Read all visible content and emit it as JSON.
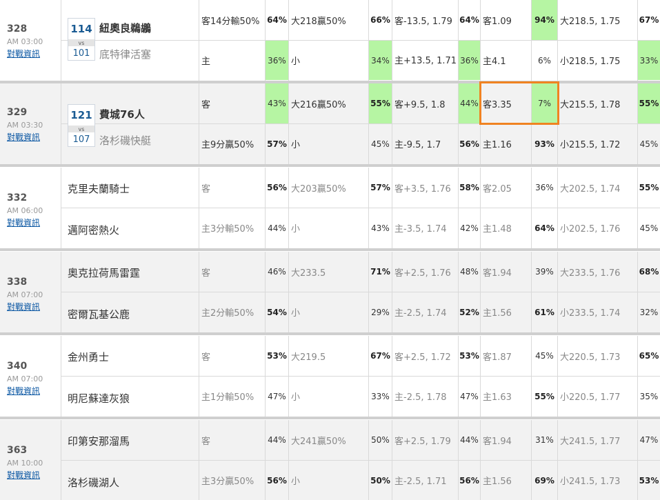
{
  "link_label": "對戰資訊",
  "vs_label": "vs",
  "games": [
    {
      "id": "328",
      "time": "AM 03:00",
      "shaded": false,
      "rotation": true,
      "dim_odds": false,
      "teams": [
        {
          "name": "紐奧良鵜鶘",
          "num": "114",
          "style": "strong"
        },
        {
          "name": "底特律活塞",
          "num": "101",
          "style": "dim"
        }
      ],
      "rows": [
        [
          {
            "t": "客14分輸50%",
            "w": "n"
          },
          {
            "t": "64%",
            "w": "b"
          },
          {
            "t": "大218贏50%",
            "w": "n"
          },
          {
            "t": "66%",
            "w": "b"
          },
          {
            "t": "客-13.5, 1.79",
            "w": "n"
          },
          {
            "t": "64%",
            "w": "b"
          },
          {
            "t": "客1.09",
            "w": "n"
          },
          {
            "t": "94%",
            "w": "b",
            "hi": true
          },
          {
            "t": "大218.5, 1.75",
            "w": "n"
          },
          {
            "t": "67%",
            "w": "b"
          }
        ],
        [
          {
            "t": "主",
            "w": "n"
          },
          {
            "t": "36%",
            "w": "n",
            "hi": true
          },
          {
            "t": "小",
            "w": "n"
          },
          {
            "t": "34%",
            "w": "n",
            "hi": true
          },
          {
            "t": "主+13.5, 1.71",
            "w": "n",
            "wrap": true
          },
          {
            "t": "36%",
            "w": "n",
            "hi": true
          },
          {
            "t": "主4.1",
            "w": "n"
          },
          {
            "t": "6%",
            "w": "n"
          },
          {
            "t": "小218.5, 1.75",
            "w": "n"
          },
          {
            "t": "33%",
            "w": "n",
            "hi": true
          }
        ]
      ]
    },
    {
      "id": "329",
      "time": "AM 03:30",
      "shaded": true,
      "rotation": true,
      "dim_odds": false,
      "teams": [
        {
          "name": "費城76人",
          "num": "121",
          "style": "strong"
        },
        {
          "name": "洛杉磯快艇",
          "num": "107",
          "style": "dim"
        }
      ],
      "rows": [
        [
          {
            "t": "客",
            "w": "n"
          },
          {
            "t": "43%",
            "w": "n",
            "hi": true
          },
          {
            "t": "大216贏50%",
            "w": "n"
          },
          {
            "t": "55%",
            "w": "b",
            "hi": true
          },
          {
            "t": "客+9.5, 1.8",
            "w": "n"
          },
          {
            "t": "44%",
            "w": "n",
            "hi": true
          },
          {
            "t": "客3.35",
            "w": "n"
          },
          {
            "t": "7%",
            "w": "n",
            "hi": true
          },
          {
            "t": "大215.5, 1.78",
            "w": "n"
          },
          {
            "t": "55%",
            "w": "b",
            "hi": true
          }
        ],
        [
          {
            "t": "主9分贏50%",
            "w": "n"
          },
          {
            "t": "57%",
            "w": "b"
          },
          {
            "t": "小",
            "w": "n"
          },
          {
            "t": "45%",
            "w": "n"
          },
          {
            "t": "主-9.5, 1.7",
            "w": "n"
          },
          {
            "t": "56%",
            "w": "b"
          },
          {
            "t": "主1.16",
            "w": "n"
          },
          {
            "t": "93%",
            "w": "b"
          },
          {
            "t": "小215.5, 1.72",
            "w": "n"
          },
          {
            "t": "45%",
            "w": "n"
          }
        ]
      ]
    },
    {
      "id": "332",
      "time": "AM 06:00",
      "shaded": false,
      "rotation": false,
      "dim_odds": true,
      "teams": [
        {
          "name": "克里夫蘭騎士",
          "style": "plain"
        },
        {
          "name": "邁阿密熱火",
          "style": "plain"
        }
      ],
      "rows": [
        [
          {
            "t": "客",
            "w": "g"
          },
          {
            "t": "56%",
            "w": "b"
          },
          {
            "t": "大203贏50%",
            "w": "g"
          },
          {
            "t": "57%",
            "w": "b"
          },
          {
            "t": "客+3.5, 1.76",
            "w": "g"
          },
          {
            "t": "58%",
            "w": "b"
          },
          {
            "t": "客2.05",
            "w": "g"
          },
          {
            "t": "36%",
            "w": "n"
          },
          {
            "t": "大202.5, 1.74",
            "w": "g"
          },
          {
            "t": "55%",
            "w": "b"
          }
        ],
        [
          {
            "t": "主3分輸50%",
            "w": "g"
          },
          {
            "t": "44%",
            "w": "n"
          },
          {
            "t": "小",
            "w": "g"
          },
          {
            "t": "43%",
            "w": "n"
          },
          {
            "t": "主-3.5, 1.74",
            "w": "g"
          },
          {
            "t": "42%",
            "w": "n"
          },
          {
            "t": "主1.48",
            "w": "g"
          },
          {
            "t": "64%",
            "w": "b"
          },
          {
            "t": "小202.5, 1.76",
            "w": "g"
          },
          {
            "t": "45%",
            "w": "n"
          }
        ]
      ]
    },
    {
      "id": "338",
      "time": "AM 07:00",
      "shaded": true,
      "rotation": false,
      "dim_odds": true,
      "teams": [
        {
          "name": "奧克拉荷馬雷霆",
          "style": "plain"
        },
        {
          "name": "密爾瓦基公鹿",
          "style": "plain"
        }
      ],
      "rows": [
        [
          {
            "t": "客",
            "w": "g"
          },
          {
            "t": "46%",
            "w": "n"
          },
          {
            "t": "大233.5",
            "w": "g"
          },
          {
            "t": "71%",
            "w": "b"
          },
          {
            "t": "客+2.5, 1.76",
            "w": "g"
          },
          {
            "t": "48%",
            "w": "n"
          },
          {
            "t": "客1.94",
            "w": "g"
          },
          {
            "t": "39%",
            "w": "n"
          },
          {
            "t": "大233.5, 1.76",
            "w": "g"
          },
          {
            "t": "68%",
            "w": "b"
          }
        ],
        [
          {
            "t": "主2分輸50%",
            "w": "g"
          },
          {
            "t": "54%",
            "w": "b"
          },
          {
            "t": "小",
            "w": "g"
          },
          {
            "t": "29%",
            "w": "n"
          },
          {
            "t": "主-2.5, 1.74",
            "w": "g"
          },
          {
            "t": "52%",
            "w": "b"
          },
          {
            "t": "主1.56",
            "w": "g"
          },
          {
            "t": "61%",
            "w": "b"
          },
          {
            "t": "小233.5, 1.74",
            "w": "g"
          },
          {
            "t": "32%",
            "w": "n"
          }
        ]
      ]
    },
    {
      "id": "340",
      "time": "AM 07:00",
      "shaded": false,
      "rotation": false,
      "dim_odds": true,
      "teams": [
        {
          "name": "金州勇士",
          "style": "plain"
        },
        {
          "name": "明尼蘇達灰狼",
          "style": "plain"
        }
      ],
      "rows": [
        [
          {
            "t": "客",
            "w": "g"
          },
          {
            "t": "53%",
            "w": "b"
          },
          {
            "t": "大219.5",
            "w": "g"
          },
          {
            "t": "67%",
            "w": "b"
          },
          {
            "t": "客+2.5, 1.72",
            "w": "g"
          },
          {
            "t": "53%",
            "w": "b"
          },
          {
            "t": "客1.87",
            "w": "g"
          },
          {
            "t": "45%",
            "w": "n"
          },
          {
            "t": "大220.5, 1.73",
            "w": "g"
          },
          {
            "t": "65%",
            "w": "b"
          }
        ],
        [
          {
            "t": "主1分輸50%",
            "w": "g"
          },
          {
            "t": "47%",
            "w": "n"
          },
          {
            "t": "小",
            "w": "g"
          },
          {
            "t": "33%",
            "w": "n"
          },
          {
            "t": "主-2.5, 1.78",
            "w": "g"
          },
          {
            "t": "47%",
            "w": "n"
          },
          {
            "t": "主1.63",
            "w": "g"
          },
          {
            "t": "55%",
            "w": "b"
          },
          {
            "t": "小220.5, 1.77",
            "w": "g"
          },
          {
            "t": "35%",
            "w": "n"
          }
        ]
      ]
    },
    {
      "id": "363",
      "time": "AM 10:00",
      "shaded": true,
      "rotation": false,
      "dim_odds": true,
      "teams": [
        {
          "name": "印第安那溜馬",
          "style": "plain"
        },
        {
          "name": "洛杉磯湖人",
          "style": "plain"
        }
      ],
      "rows": [
        [
          {
            "t": "客",
            "w": "g"
          },
          {
            "t": "44%",
            "w": "n"
          },
          {
            "t": "大241贏50%",
            "w": "g"
          },
          {
            "t": "50%",
            "w": "n"
          },
          {
            "t": "客+2.5, 1.79",
            "w": "g"
          },
          {
            "t": "44%",
            "w": "n"
          },
          {
            "t": "客1.94",
            "w": "g"
          },
          {
            "t": "31%",
            "w": "n"
          },
          {
            "t": "大241.5, 1.77",
            "w": "g"
          },
          {
            "t": "47%",
            "w": "n"
          }
        ],
        [
          {
            "t": "主3分贏50%",
            "w": "g"
          },
          {
            "t": "56%",
            "w": "b"
          },
          {
            "t": "小",
            "w": "g"
          },
          {
            "t": "50%",
            "w": "b"
          },
          {
            "t": "主-2.5, 1.71",
            "w": "g"
          },
          {
            "t": "56%",
            "w": "b"
          },
          {
            "t": "主1.56",
            "w": "g"
          },
          {
            "t": "69%",
            "w": "b"
          },
          {
            "t": "小241.5, 1.73",
            "w": "g"
          },
          {
            "t": "53%",
            "w": "b"
          }
        ]
      ]
    }
  ],
  "highlight": {
    "game": 1,
    "row": 0,
    "cols": [
      6,
      7
    ]
  },
  "colors": {
    "highlight_green": "#b6f5a3",
    "frame_orange": "#f08321",
    "link_blue": "#0b57a3",
    "rotation_blue": "#1a5b93"
  }
}
